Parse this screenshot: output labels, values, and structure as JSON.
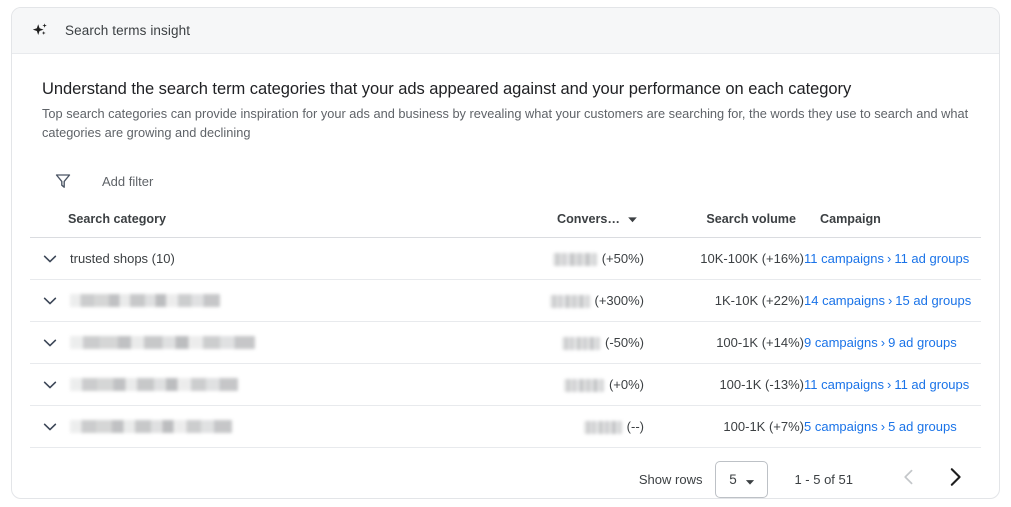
{
  "card": {
    "header": {
      "icon": "sparkle-icon",
      "title": "Search terms insight"
    },
    "headline": "Understand the search term categories that your ads appeared against and your performance on each category",
    "subhead": "Top search categories can provide inspiration for your ads and business by revealing what your customers are searching for, the words they use to search and what categories are growing and declining",
    "filter": {
      "icon": "filter-icon",
      "label": "Add filter"
    },
    "table": {
      "columns": {
        "category": "Search category",
        "conversions": "Convers…",
        "search_volume": "Search volume",
        "campaign": "Campaign"
      },
      "sort_icon": "sort-descending-arrow-icon",
      "rows": [
        {
          "expand_icon": "chevron-down-icon",
          "category": "trusted shops (10)",
          "category_redacted": false,
          "conversions_value_redacted": true,
          "conversions_delta": "(+50%)",
          "search_volume": "10K-100K (+16%)",
          "campaigns_link": "11 campaigns",
          "campaign_separator": "›",
          "ad_groups_link": "11 ad groups"
        },
        {
          "expand_icon": "chevron-down-icon",
          "category": "",
          "category_redacted": true,
          "conversions_value_redacted": true,
          "conversions_delta": "(+300%)",
          "search_volume": "1K-10K (+22%)",
          "campaigns_link": "14 campaigns",
          "campaign_separator": "›",
          "ad_groups_link": "15 ad groups"
        },
        {
          "expand_icon": "chevron-down-icon",
          "category": "",
          "category_redacted": true,
          "conversions_value_redacted": true,
          "conversions_delta": "(-50%)",
          "search_volume": "100-1K (+14%)",
          "campaigns_link": "9 campaigns",
          "campaign_separator": "›",
          "ad_groups_link": "9 ad groups"
        },
        {
          "expand_icon": "chevron-down-icon",
          "category": "",
          "category_redacted": true,
          "conversions_value_redacted": true,
          "conversions_delta": "(+0%)",
          "search_volume": "100-1K (-13%)",
          "campaigns_link": "11 campaigns",
          "campaign_separator": "›",
          "ad_groups_link": "11 ad groups"
        },
        {
          "expand_icon": "chevron-down-icon",
          "category": "",
          "category_redacted": true,
          "conversions_value_redacted": true,
          "conversions_delta": "(--)",
          "search_volume": "100-1K (+7%)",
          "campaigns_link": "5 campaigns",
          "campaign_separator": "›",
          "ad_groups_link": "5 ad groups"
        }
      ]
    },
    "pagination": {
      "show_rows_label": "Show rows",
      "rows_per_page": "5",
      "rows_caret_icon": "caret-down-icon",
      "range_label": "1 - 5 of 51",
      "prev_icon": "chevron-left-icon",
      "next_icon": "chevron-right-icon",
      "prev_enabled": false,
      "next_enabled": true
    }
  },
  "colors": {
    "link": "#1a73e8",
    "text_primary": "#3c4043",
    "text_secondary": "#5f6368",
    "header_band": "#f6f7f8",
    "border": "#e8eaed"
  }
}
